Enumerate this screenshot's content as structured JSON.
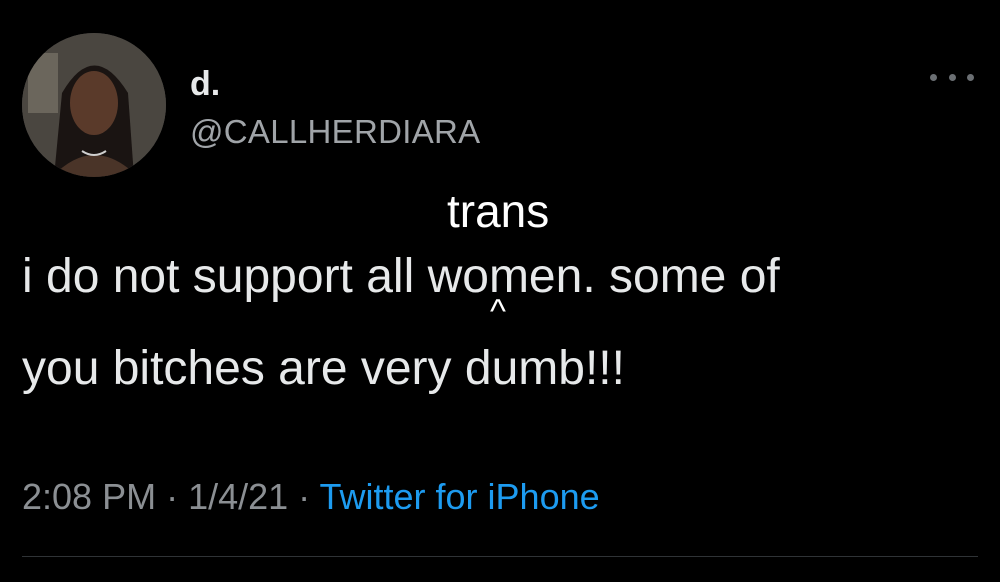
{
  "user": {
    "display_name": "d.",
    "handle": "@CALLHERDIARA"
  },
  "tweet": {
    "line1": "i do not support all women. some of",
    "line2": "you bitches are very dumb!!!",
    "edit_insert": "trans",
    "caret": "^"
  },
  "meta": {
    "time": "2:08 PM",
    "sep1": " · ",
    "date": "1/4/21",
    "sep2": " · ",
    "source": "Twitter for iPhone"
  },
  "icons": {
    "more": "more-horizontal-icon",
    "avatar": "profile-avatar"
  },
  "colors": {
    "background": "#000000",
    "text": "#e7e9ea",
    "muted": "#8b8f93",
    "link": "#1d9bf0"
  }
}
